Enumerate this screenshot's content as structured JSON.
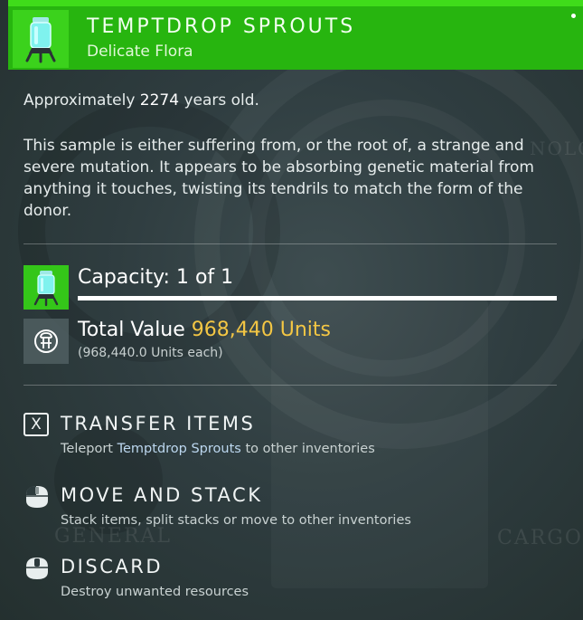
{
  "header": {
    "title": "TEMPTDROP SPROUTS",
    "subtitle": "Delicate Flora",
    "icon": "specimen-jar-icon",
    "accent": "#27b50f"
  },
  "info": {
    "age_prefix": "Approximately",
    "age_value": "2274",
    "age_suffix": "years old.",
    "description": "This sample is either suffering from, or the root of, a strange and severe mutation. It appears to be absorbing genetic material from anything it touches, twisting its tendrils to match the form of the donor."
  },
  "capacity": {
    "label": "Capacity: 1 of 1",
    "fill_fraction": 1.0
  },
  "value": {
    "label": "Total Value",
    "amount": "968,440 Units",
    "each": "(968,440.0 Units each)",
    "amount_color": "#f3c644"
  },
  "actions": [
    {
      "key_icon": "x-key-icon",
      "key_label": "X",
      "title": "TRANSFER ITEMS",
      "desc_prefix": "Teleport",
      "desc_highlight": "Temptdrop Sprouts",
      "desc_suffix": "to other inventories"
    },
    {
      "key_icon": "mouse-left-click-icon",
      "title": "MOVE AND STACK",
      "desc": "Stack items, split stacks or move to other inventories"
    },
    {
      "key_icon": "mouse-middle-click-icon",
      "title": "DISCARD",
      "desc": "Destroy unwanted resources"
    }
  ],
  "background": {
    "label_left": "GENERAL",
    "label_right": "CARGO",
    "label_top": "NOLO"
  }
}
